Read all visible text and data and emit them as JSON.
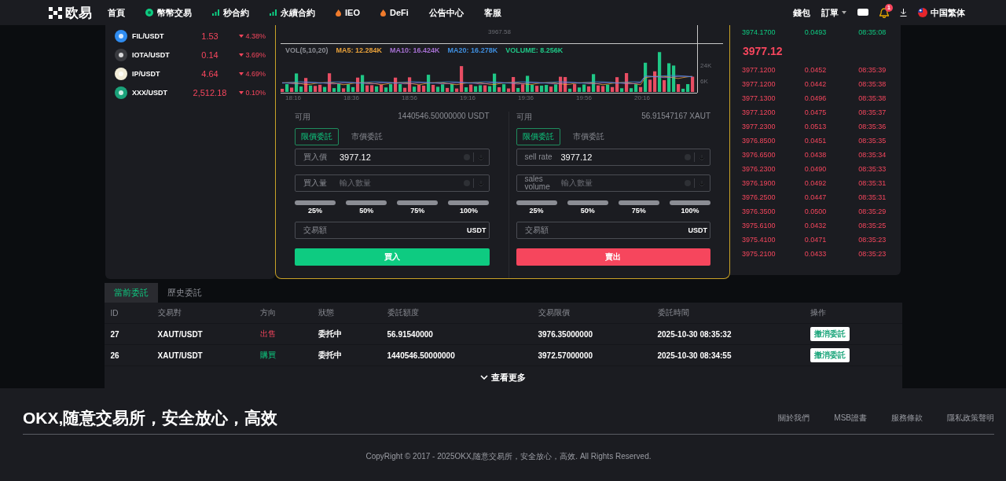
{
  "header": {
    "logo": "欧易",
    "nav": [
      {
        "label": "首頁",
        "kind": "plain"
      },
      {
        "label": "幣幣交易",
        "kind": "coin"
      },
      {
        "label": "秒合約",
        "kind": "bars"
      },
      {
        "label": "永續合約",
        "kind": "bars"
      },
      {
        "label": "IEO",
        "kind": "flame"
      },
      {
        "label": "DeFi",
        "kind": "flame"
      },
      {
        "label": "公告中心",
        "kind": "plain"
      },
      {
        "label": "客服",
        "kind": "plain"
      }
    ],
    "wallet": "錢包",
    "orders": "訂單",
    "notification_count": "1",
    "language": "中国繁体"
  },
  "markets": [
    {
      "pair": "FIL/USDT",
      "price": "1.53",
      "change": "4.38%",
      "kind": "down",
      "color": "#2f8cf0"
    },
    {
      "pair": "IOTA/USDT",
      "price": "0.14",
      "change": "3.69%",
      "kind": "down",
      "color": "#3a3b40"
    },
    {
      "pair": "IP/USDT",
      "price": "4.64",
      "change": "4.69%",
      "kind": "down",
      "color": "#f1ecd8"
    },
    {
      "pair": "XXX/USDT",
      "price": "2,512.18",
      "change": "0.10%",
      "kind": "down",
      "color": "#1ba27a"
    }
  ],
  "chart": {
    "price_label": "3967.58",
    "legend": [
      {
        "text": "VOL(5,10,20)",
        "color": "#8b8d94"
      },
      {
        "text": "MA5: 12.284K",
        "color": "#e8a13a"
      },
      {
        "text": "MA10: 16.424K",
        "color": "#a46fd0"
      },
      {
        "text": "MA20: 16.278K",
        "color": "#3f8fe0"
      },
      {
        "text": "VOLUME: 8.256K",
        "color": "#1fc786"
      }
    ],
    "x_labels": [
      "18:16",
      "18:36",
      "18:56",
      "19:16",
      "19:36",
      "19:56",
      "20:16"
    ],
    "y_labels": [
      "24K",
      "6K"
    ]
  },
  "buy_form": {
    "available_label": "可用",
    "available": "1440546.50000000 USDT",
    "order_types": [
      {
        "label": "限價委託",
        "selected": true
      },
      {
        "label": "市價委託",
        "selected": false
      }
    ],
    "price_label": "買入價",
    "price": "3977.12",
    "amount_label": "買入量",
    "amount_placeholder": "輸入數量",
    "percents": [
      "25%",
      "50%",
      "75%",
      "100%"
    ],
    "total_label": "交易額",
    "total_unit": "USDT",
    "submit": "買入"
  },
  "sell_form": {
    "available_label": "可用",
    "available": "56.91547167 XAUT",
    "order_types": [
      {
        "label": "限價委託",
        "selected": true
      },
      {
        "label": "市價委託",
        "selected": false
      }
    ],
    "price_label": "sell rate",
    "price": "3977.12",
    "amount_label": "sales volume",
    "amount_placeholder": "輸入數量",
    "percents": [
      "25%",
      "50%",
      "75%",
      "100%"
    ],
    "total_label": "交易額",
    "total_unit": "USDT",
    "submit": "賣出"
  },
  "trades_top": [
    {
      "price": "3974.1700",
      "amount": "0.0493",
      "time": "08:35:08",
      "kind": "buy"
    }
  ],
  "last_price": "3977.12",
  "trades": [
    {
      "price": "3977.1200",
      "amount": "0.0452",
      "time": "08:35:39",
      "kind": "sell"
    },
    {
      "price": "3977.1200",
      "amount": "0.0442",
      "time": "08:35:38",
      "kind": "sell"
    },
    {
      "price": "3977.1300",
      "amount": "0.0496",
      "time": "08:35:38",
      "kind": "sell"
    },
    {
      "price": "3977.1200",
      "amount": "0.0475",
      "time": "08:35:37",
      "kind": "sell"
    },
    {
      "price": "3977.2300",
      "amount": "0.0513",
      "time": "08:35:36",
      "kind": "sell"
    },
    {
      "price": "3976.8500",
      "amount": "0.0451",
      "time": "08:35:35",
      "kind": "sell"
    },
    {
      "price": "3976.6500",
      "amount": "0.0438",
      "time": "08:35:34",
      "kind": "sell"
    },
    {
      "price": "3976.2300",
      "amount": "0.0490",
      "time": "08:35:33",
      "kind": "sell"
    },
    {
      "price": "3976.1900",
      "amount": "0.0492",
      "time": "08:35:31",
      "kind": "sell"
    },
    {
      "price": "3976.2500",
      "amount": "0.0447",
      "time": "08:35:31",
      "kind": "sell"
    },
    {
      "price": "3976.3500",
      "amount": "0.0500",
      "time": "08:35:29",
      "kind": "sell"
    },
    {
      "price": "3975.6100",
      "amount": "0.0432",
      "time": "08:35:25",
      "kind": "sell"
    },
    {
      "price": "3975.4100",
      "amount": "0.0471",
      "time": "08:35:23",
      "kind": "sell"
    },
    {
      "price": "3975.2100",
      "amount": "0.0433",
      "time": "08:35:23",
      "kind": "sell"
    }
  ],
  "orders": {
    "tabs": [
      {
        "label": "當前委託",
        "selected": true
      },
      {
        "label": "歷史委託",
        "selected": false
      }
    ],
    "columns": [
      "ID",
      "交易對",
      "方向",
      "狀態",
      "委託額度",
      "交易限價",
      "委託時間",
      "操作"
    ],
    "rows": [
      {
        "id": "27",
        "pair": "XAUT/USDT",
        "direction": "出售",
        "kind": "sell",
        "status": "委托中",
        "amount": "56.91540000",
        "limit": "3976.35000000",
        "time": "2025-10-30 08:35:32",
        "action": "撤消委託"
      },
      {
        "id": "26",
        "pair": "XAUT/USDT",
        "direction": "購買",
        "kind": "buy",
        "status": "委托中",
        "amount": "1440546.50000000",
        "limit": "3972.57000000",
        "time": "2025-10-30 08:34:55",
        "action": "撤消委託"
      }
    ],
    "more": "查看更多"
  },
  "footer": {
    "title": "OKX,随意交易所，安全放心，高效",
    "links": [
      "關於我們",
      "MSB證書",
      "服務條款",
      "隱私政策聲明"
    ],
    "copyright": "CopyRight © 2017 - 2025OKX,随意交易所，安全放心，高效. All Rights Reserved."
  }
}
